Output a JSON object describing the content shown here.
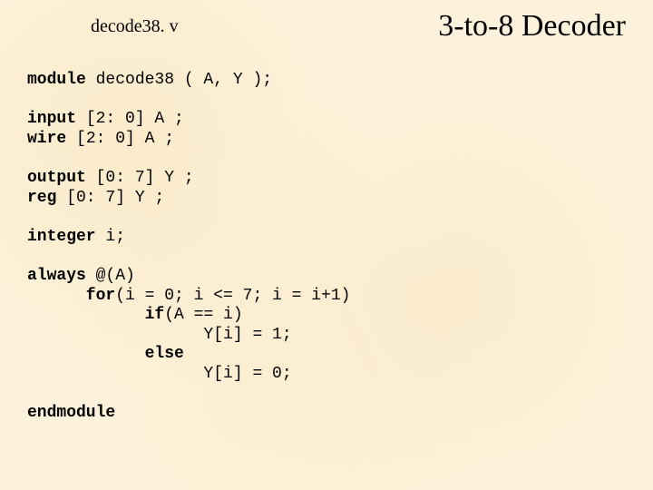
{
  "filename": "decode38. v",
  "title": "3-to-8 Decoder",
  "code": {
    "l1a": "module",
    "l1b": " decode38 ( A, Y );",
    "l2a": "input",
    "l2b": " [2: 0] A ;",
    "l3a": "wire",
    "l3b": " [2: 0] A ;",
    "l4a": "output",
    "l4b": " [0: 7] Y ;",
    "l5a": "reg",
    "l5b": " [0: 7] Y ;",
    "l6a": "integer",
    "l6b": " i;",
    "l7a": "always",
    "l7b": " @(A)",
    "l8a": "      for",
    "l8b": "(i = 0; i <= 7; i = i+1)",
    "l9a": "            if",
    "l9b": "(A == i)",
    "l10": "                  Y[i] = 1;",
    "l11a": "            else",
    "l12": "                  Y[i] = 0;",
    "l13a": "endmodule"
  }
}
